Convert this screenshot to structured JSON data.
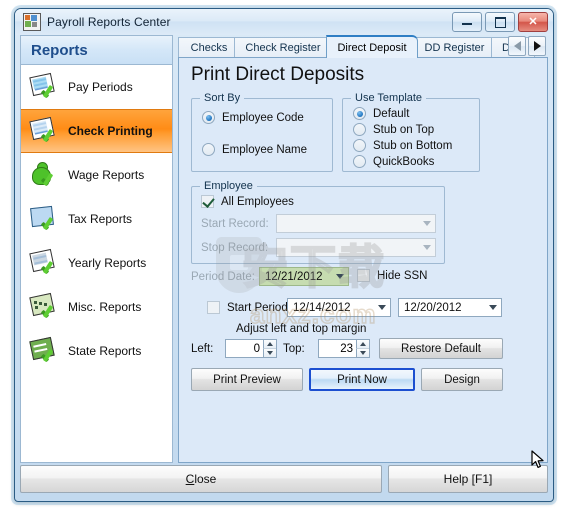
{
  "window": {
    "title": "Payroll Reports Center",
    "icon": "app-icon",
    "controls": {
      "minimize": "minimize",
      "maximize": "maximize",
      "close": "close"
    }
  },
  "sidebar": {
    "header": "Reports",
    "items": [
      {
        "label": "Pay Periods",
        "icon": "report-pages-icon",
        "selected": false
      },
      {
        "label": "Check Printing",
        "icon": "check-printing-icon",
        "selected": true
      },
      {
        "label": "Wage Reports",
        "icon": "wage-person-icon",
        "selected": false
      },
      {
        "label": "Tax Reports",
        "icon": "tax-book-icon",
        "selected": false
      },
      {
        "label": "Yearly Reports",
        "icon": "yearly-clipboard-icon",
        "selected": false
      },
      {
        "label": "Misc. Reports",
        "icon": "misc-calculator-icon",
        "selected": false
      },
      {
        "label": "State Reports",
        "icon": "state-report-icon",
        "selected": false
      }
    ]
  },
  "tabs": {
    "items": [
      {
        "label": "Checks",
        "active": false
      },
      {
        "label": "Check Register",
        "active": false
      },
      {
        "label": "Direct Deposit",
        "active": true
      },
      {
        "label": "DD Register",
        "active": false
      },
      {
        "label": "DD I",
        "active": false
      }
    ],
    "nav_prev": "scroll-tabs-left",
    "nav_next": "scroll-tabs-right"
  },
  "page": {
    "title": "Print Direct Deposits",
    "sort_by": {
      "caption": "Sort By",
      "options": [
        {
          "label": "Employee Code",
          "selected": true
        },
        {
          "label": "Employee Name",
          "selected": false
        }
      ]
    },
    "use_template": {
      "caption": "Use Template",
      "options": [
        {
          "label": "Default",
          "selected": true
        },
        {
          "label": "Stub on Top",
          "selected": false
        },
        {
          "label": "Stub on Bottom",
          "selected": false
        },
        {
          "label": "QuickBooks",
          "selected": false
        }
      ]
    },
    "employee": {
      "caption": "Employee",
      "all_employees": {
        "label": "All Employees",
        "checked": true
      },
      "start_record": {
        "label": "Start Record:",
        "value": "",
        "disabled": true
      },
      "stop_record": {
        "label": "Stop Record:",
        "value": "",
        "disabled": true
      }
    },
    "period_date": {
      "label": "Period Date:",
      "value": "12/21/2012"
    },
    "hide_ssn": {
      "label": "Hide SSN",
      "checked": false
    },
    "start_period": {
      "label": "Start Period:",
      "checked": false,
      "from": "12/14/2012",
      "to": "12/20/2012"
    },
    "margin": {
      "hint": "Adjust left and top margin",
      "left_label": "Left:",
      "left_value": "0",
      "top_label": "Top:",
      "top_value": "23",
      "restore_label": "Restore Default"
    },
    "actions": {
      "print_preview": "Print Preview",
      "print_now": "Print Now",
      "design": "Design"
    }
  },
  "footer": {
    "close": "Close",
    "close_accel": "C",
    "close_rest": "lose",
    "help": "Help [F1]"
  },
  "watermark": {
    "cn": "安下载",
    "en": "anxz.com"
  },
  "colors": {
    "accent_selected": "#ff8c16",
    "panel_bg": "#dce9f8",
    "focus_border": "#1c4fd0",
    "period_date_bg": "#c6dcb0",
    "title_blue": "#1f4e8c"
  }
}
